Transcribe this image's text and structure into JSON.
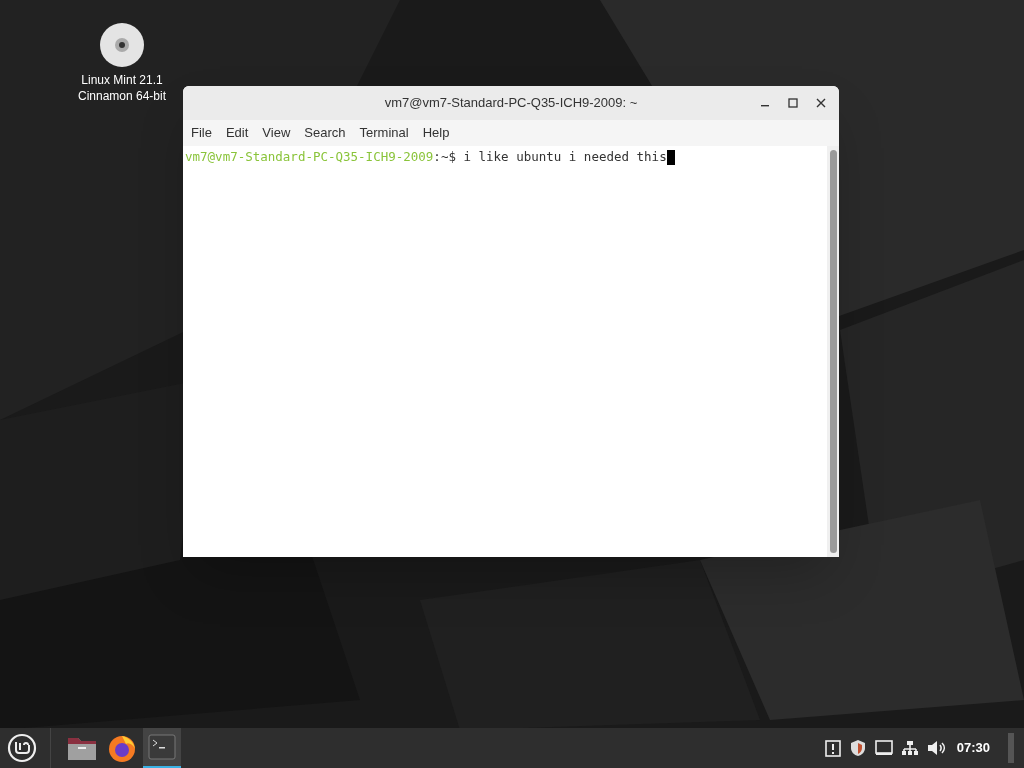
{
  "desktop_icons": [
    {
      "label": "Linux Mint 21.1\nCinnamon 64-bit"
    }
  ],
  "window": {
    "title": "vm7@vm7-Standard-PC-Q35-ICH9-2009: ~"
  },
  "menu": [
    "File",
    "Edit",
    "View",
    "Search",
    "Terminal",
    "Help"
  ],
  "terminal": {
    "prompt_user": "vm7@vm7-Standard-PC-Q35-ICH9-2009",
    "prompt_rest": ":~$ i like ubuntu i needed this",
    "cursor": true
  },
  "taskbar": {
    "launchers": [
      {
        "kind": "files",
        "selected": false
      },
      {
        "kind": "browser",
        "selected": false
      },
      {
        "kind": "terminal",
        "selected": true
      }
    ],
    "tray": [
      {
        "kind": "clipboard"
      },
      {
        "kind": "shield"
      },
      {
        "kind": "display"
      },
      {
        "kind": "network"
      },
      {
        "kind": "volume"
      }
    ],
    "clock": "07:30"
  }
}
